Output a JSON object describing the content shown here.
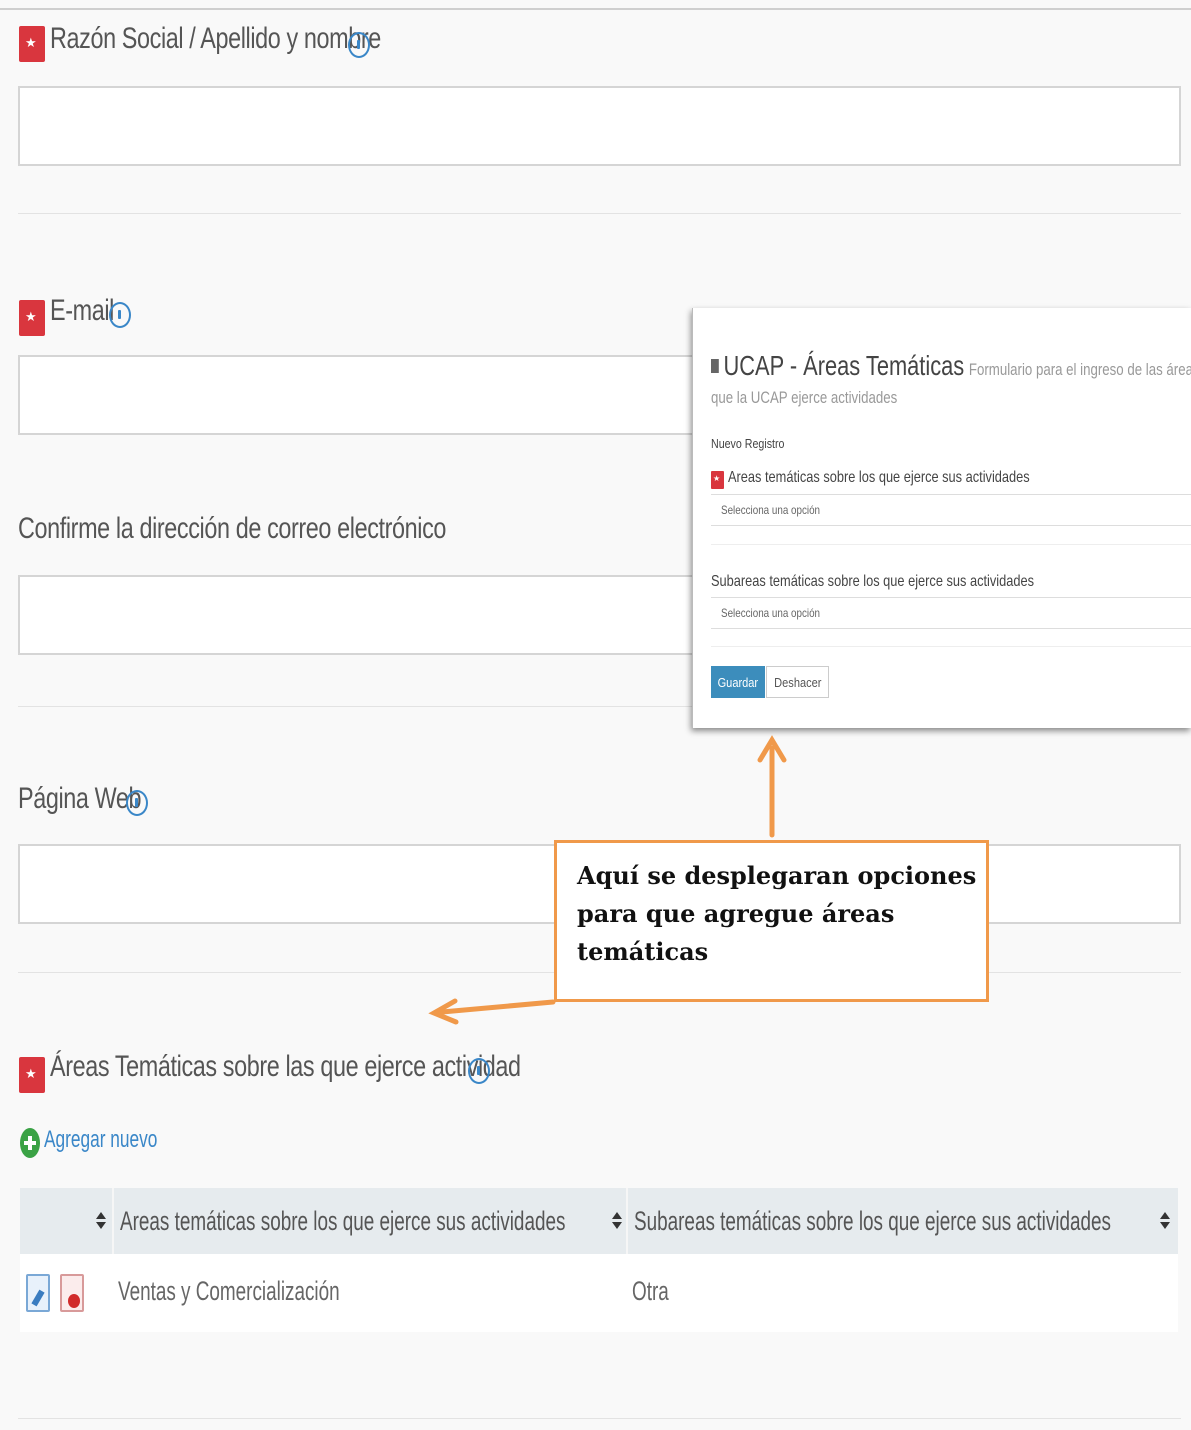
{
  "form": {
    "razon_social": {
      "label": "Razón Social / Apellido y nombre",
      "value": ""
    },
    "email": {
      "label": "E-mail",
      "value": ""
    },
    "confirm_email": {
      "label": "Confirme la dirección de correo electrónico",
      "value": ""
    },
    "web": {
      "label": "Página Web",
      "value": ""
    },
    "areas": {
      "label": "Áreas Temáticas sobre las que ejerce actividad"
    }
  },
  "add_new": {
    "label": "Agregar nuevo"
  },
  "table": {
    "columns": [
      "Areas temáticas sobre los que ejerce sus actividades",
      "Subareas temáticas sobre los que ejerce sus actividades"
    ],
    "rows": [
      {
        "area": "Ventas y Comercialización",
        "subarea": "Otra"
      }
    ]
  },
  "popup": {
    "title": "UCAP - Áreas Temáticas",
    "subtitle_1": "Formulario para el ingreso de las áreas temá",
    "subtitle_2": "que la UCAP ejerce actividades",
    "section": "Nuevo Registro",
    "area_label": "Areas temáticas sobre los que ejerce sus actividades",
    "area_placeholder": "Selecciona una opción",
    "subarea_label": "Subareas temáticas sobre los que ejerce sus actividades",
    "subarea_placeholder": "Selecciona una opción",
    "save_label": "Guardar",
    "undo_label": "Deshacer"
  },
  "callout": {
    "text": "Aquí se desplegaran opciones para que agregue áreas temáticas",
    "border_color": "#f0994a"
  },
  "colors": {
    "required_badge": "#d9363e",
    "help_icon": "#3a87c8",
    "add_icon": "#3aa245",
    "primary_button": "#3c8dbc"
  }
}
